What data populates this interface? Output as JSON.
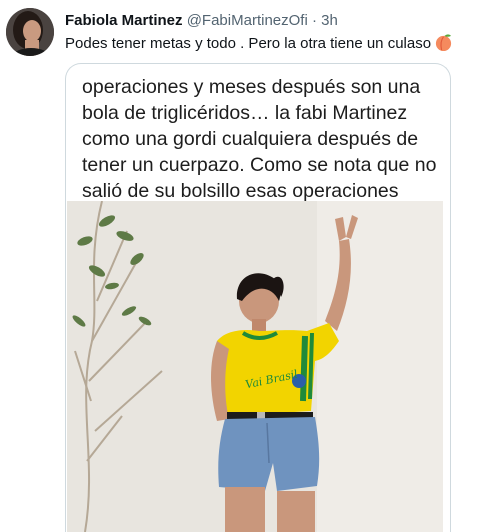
{
  "tweet": {
    "author_name": "Fabiola Martinez",
    "handle": "@FabiMartinezOfi",
    "separator": "·",
    "time": "3h",
    "text": "Podes tener metas y todo . Pero la otra tiene un culaso",
    "emoji_icon": "peach-icon"
  },
  "media": {
    "quote_lines": [
      "operaciones y meses después son una",
      "bola de triglicéridos… la fabi Martinez",
      "como una gordi cualquiera después de",
      "tener un cuerpazo. Como se nota que no",
      "salió de su bolsillo esas operaciones"
    ],
    "shirt_text": "Vai Brasil"
  },
  "colors": {
    "name": "#0f1419",
    "secondary": "#536471",
    "border": "#cfd9de",
    "shirt_yellow": "#f2d400",
    "shirt_green": "#1f8a3a",
    "denim": "#6f93bf"
  }
}
